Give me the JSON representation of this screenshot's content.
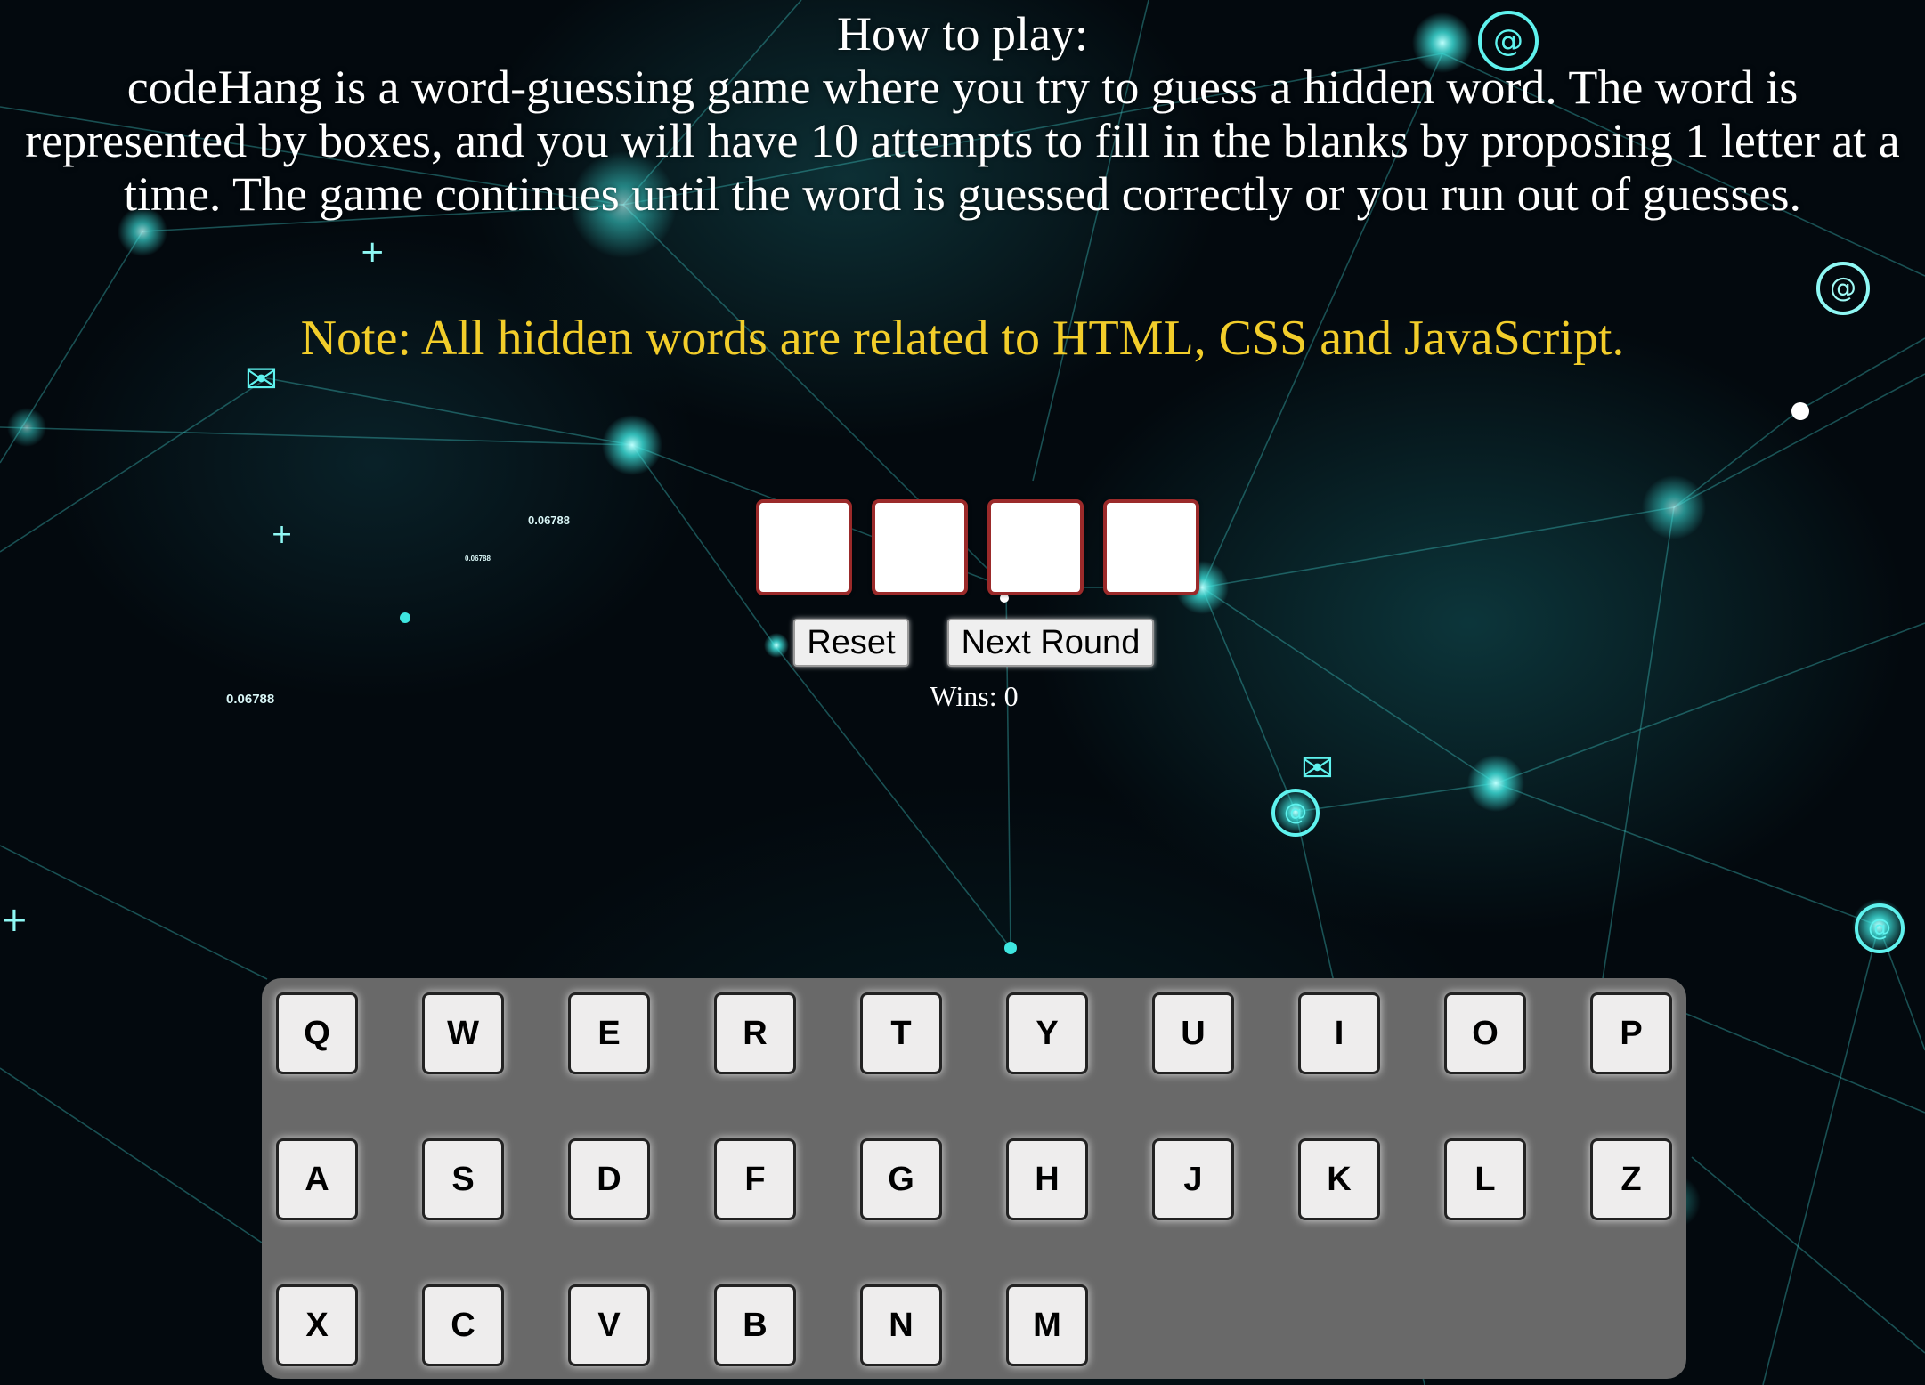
{
  "instructions": {
    "heading": "How to play:",
    "body": "codeHang is a word-guessing game where you try to guess a hidden word. The word is represented by boxes, and you will have 10 attempts to fill in the blanks by proposing 1 letter at a time. The game continues until the word is guessed correctly or you run out of guesses."
  },
  "note": "Note: All hidden words are related to HTML, CSS and JavaScript.",
  "word_boxes": [
    "",
    "",
    "",
    ""
  ],
  "buttons": {
    "reset_label": "Reset",
    "next_label": "Next Round"
  },
  "wins": "Wins: 0",
  "keyboard": {
    "rows": [
      [
        "Q",
        "W",
        "E",
        "R",
        "T",
        "Y",
        "U",
        "I",
        "O",
        "P"
      ],
      [
        "A",
        "S",
        "D",
        "F",
        "G",
        "H",
        "J",
        "K",
        "L",
        "Z"
      ],
      [
        "X",
        "C",
        "V",
        "B",
        "N",
        "M"
      ]
    ]
  },
  "background": {
    "number_labels": [
      "0.06788",
      "0.06788",
      "0.06788"
    ],
    "icons": [
      "at-icon",
      "at-icon",
      "at-icon",
      "at-icon",
      "envelope-icon",
      "envelope-icon",
      "plus-icon",
      "plus-icon",
      "plus-icon"
    ]
  },
  "colors": {
    "note": "#f2cd2a",
    "box_border": "#9b2a2a",
    "keyboard_panel": "#696969",
    "network_cyan": "#3ee6e0"
  }
}
